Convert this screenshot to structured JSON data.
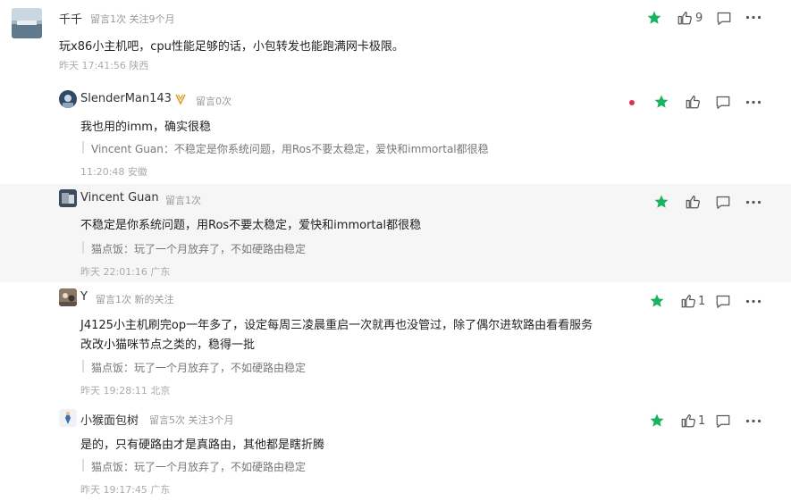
{
  "comments": [
    {
      "name": "千千",
      "meta": "留言1次 关注9个月",
      "body": "玩x86小主机吧，cpu性能足够的话，小包转发也能跑满网卡极限。",
      "time": "昨天 17:41:56 陕西",
      "likes": "9"
    },
    {
      "name": "SlenderMan143",
      "meta": "留言0次",
      "body": "我也用的imm，确实很稳",
      "quote": "Vincent Guan：不稳定是你系统问题，用Ros不要太稳定，爱快和immortal都很稳",
      "time": "11:20:48 安徽",
      "likes": ""
    },
    {
      "name": "Vincent Guan",
      "meta": "留言1次",
      "body": "不稳定是你系统问题，用Ros不要太稳定，爱快和immortal都很稳",
      "quote": "猫点饭：玩了一个月放弃了，不如硬路由稳定",
      "time": "昨天 22:01:16 广东",
      "likes": ""
    },
    {
      "name": "Y",
      "meta": "留言1次 新的关注",
      "body_lines": [
        "J4125小主机刷完op一年多了，设定每周三凌晨重启一次就再也没管过，除了偶尔进软路由看看服务",
        "改改小猫咪节点之类的，稳得一批"
      ],
      "quote": "猫点饭：玩了一个月放弃了，不如硬路由稳定",
      "time": "昨天 19:28:11 北京",
      "likes": "1"
    },
    {
      "name": "小猴面包树",
      "meta": "留言5次 关注3个月",
      "body": "是的，只有硬路由才是真路由，其他都是瞎折腾",
      "quote": "猫点饭：玩了一个月放弃了，不如硬路由稳定",
      "time": "昨天 19:17:45 广东",
      "likes": "1"
    }
  ],
  "colors": {
    "star": "#19b35e",
    "dot": "#e0304a",
    "highlight": "#f6f6f6"
  },
  "icons": [
    "star-icon",
    "thumb-up-icon",
    "comment-icon",
    "more-icon",
    "badge-icon"
  ]
}
